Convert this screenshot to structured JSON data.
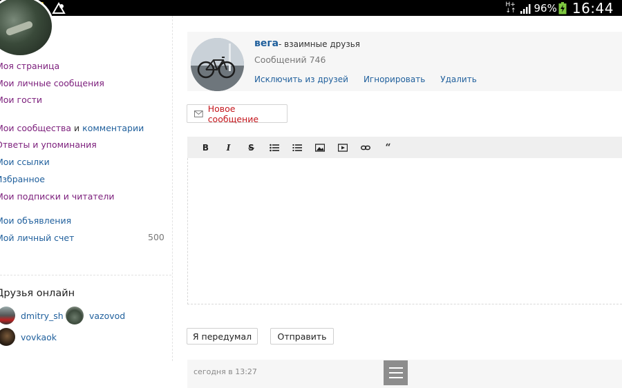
{
  "status_bar": {
    "network_top": "H+",
    "network_bottom": "↓↑",
    "battery_percent": "96%",
    "time": "16:44"
  },
  "sidebar": {
    "menu": [
      {
        "label": "Моя страница",
        "color": "purple"
      },
      {
        "label": "Мои личные сообщения",
        "color": "purple"
      },
      {
        "label": "Мои гости",
        "color": "purple"
      },
      {
        "label_a": "Мои сообщества",
        "and": "и",
        "label_b": "комментарии"
      },
      {
        "label": "Ответы и упоминания",
        "color": "purple"
      },
      {
        "label": "Мои ссылки",
        "color": "blue"
      },
      {
        "label": "Избранное",
        "color": "blue"
      },
      {
        "label": "Мои подписки и читатели",
        "color": "purple"
      },
      {
        "label": "Мои объявления",
        "color": "blue"
      },
      {
        "label": "Мой личный счет",
        "color": "blue",
        "count": "500"
      }
    ],
    "friends_title": "Друзья онлайн",
    "friends": [
      {
        "name": "dmitry_sh"
      },
      {
        "name": "vazovod"
      },
      {
        "name": "vovkaok"
      }
    ]
  },
  "profile": {
    "name": "вега",
    "relation": "- взаимные друзья",
    "messages": "Сообщений 746",
    "actions": [
      "Исключить из друзей",
      "Игнорировать",
      "Удалить"
    ]
  },
  "compose": {
    "new_message_label": "Новое сообщение",
    "toolbar": [
      "bold-icon",
      "italic-icon",
      "strikethrough-icon",
      "bulleted-list-icon",
      "numbered-list-icon",
      "image-icon",
      "video-icon",
      "link-icon",
      "quote-icon"
    ],
    "cancel_label": "Я передумал",
    "send_label": "Отправить"
  },
  "history": {
    "time": "сегодня в 13:27"
  },
  "colors": {
    "link_purple": "#7b1d7b",
    "link_blue": "#1f5f9c",
    "accent_red": "#c4161c"
  }
}
